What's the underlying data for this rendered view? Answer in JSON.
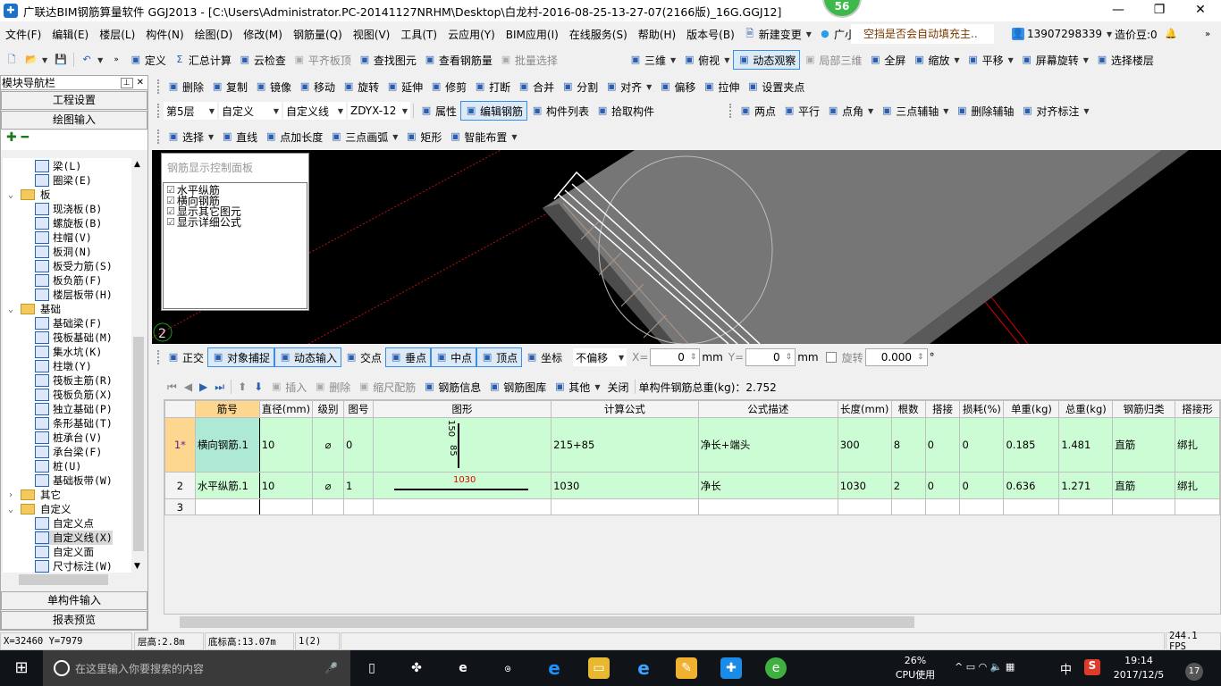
{
  "title": {
    "text": "广联达BIM钢筋算量软件 GGJ2013 - [C:\\Users\\Administrator.PC-20141127NRHM\\Desktop\\白龙村-2016-08-25-13-27-07(2166版)_16G.GGJ12]",
    "badge": "56",
    "min": "—",
    "max": "❐",
    "close": "✕"
  },
  "menu": [
    "文件(F)",
    "编辑(E)",
    "楼层(L)",
    "构件(N)",
    "绘图(D)",
    "修改(M)",
    "钢筋量(Q)",
    "视图(V)",
    "工具(T)",
    "云应用(Y)",
    "BIM应用(I)",
    "在线服务(S)",
    "帮助(H)",
    "版本号(B)"
  ],
  "menu_right": {
    "new_change": "新建变更",
    "assistant": "广小二",
    "notice": "空挡是否会自动填充主..",
    "phone": "13907298339",
    "beans": "造价豆:0"
  },
  "toolbar1": [
    {
      "label": "定义",
      "icon": "define"
    },
    {
      "label": "汇总计算",
      "icon": "Σ"
    },
    {
      "label": "云检查",
      "icon": "cloud-check"
    },
    {
      "label": "平齐板顶",
      "icon": "align-top",
      "disabled": true
    },
    {
      "label": "查找图元",
      "icon": "binoculars"
    },
    {
      "label": "查看钢筋量",
      "icon": "view-rebar"
    },
    {
      "label": "批量选择",
      "icon": "batch-select",
      "disabled": true
    }
  ],
  "toolbar1_right": [
    {
      "label": "三维",
      "icon": "cube",
      "dd": true
    },
    {
      "label": "俯视",
      "icon": "top-view",
      "dd": true
    },
    {
      "label": "动态观察",
      "icon": "orbit",
      "active": true
    },
    {
      "label": "局部三维",
      "icon": "local-3d",
      "disabled": true
    },
    {
      "label": "全屏",
      "icon": "fullscreen"
    },
    {
      "label": "缩放",
      "icon": "zoom",
      "dd": true
    },
    {
      "label": "平移",
      "icon": "pan",
      "dd": true
    },
    {
      "label": "屏幕旋转",
      "icon": "rotate-screen",
      "dd": true
    },
    {
      "label": "选择楼层",
      "icon": "select-floor"
    }
  ],
  "toolbar2": [
    {
      "label": "删除",
      "icon": "delete"
    },
    {
      "label": "复制",
      "icon": "copy"
    },
    {
      "label": "镜像",
      "icon": "mirror"
    },
    {
      "label": "移动",
      "icon": "move"
    },
    {
      "label": "旋转",
      "icon": "rotate"
    },
    {
      "label": "延伸",
      "icon": "extend"
    },
    {
      "label": "修剪",
      "icon": "trim"
    },
    {
      "label": "打断",
      "icon": "break"
    },
    {
      "label": "合并",
      "icon": "merge"
    },
    {
      "label": "分割",
      "icon": "split"
    },
    {
      "label": "对齐",
      "icon": "align",
      "dd": true
    },
    {
      "label": "偏移",
      "icon": "offset"
    },
    {
      "label": "拉伸",
      "icon": "stretch"
    },
    {
      "label": "设置夹点",
      "icon": "grip-point"
    }
  ],
  "toolbar3": {
    "floor": "第5层",
    "type": "自定义",
    "subtype": "自定义线",
    "name": "ZDYX-12",
    "buttons": [
      {
        "label": "属性",
        "icon": "properties"
      },
      {
        "label": "编辑钢筋",
        "icon": "edit-rebar",
        "active": true
      },
      {
        "label": "构件列表",
        "icon": "component-list"
      },
      {
        "label": "拾取构件",
        "icon": "pick"
      }
    ],
    "axis_buttons": [
      {
        "label": "两点",
        "icon": "two-point"
      },
      {
        "label": "平行",
        "icon": "parallel"
      },
      {
        "label": "点角",
        "icon": "point-angle",
        "dd": true
      },
      {
        "label": "三点辅轴",
        "icon": "three-point-axis",
        "dd": true
      },
      {
        "label": "删除辅轴",
        "icon": "delete-axis"
      },
      {
        "label": "对齐标注",
        "icon": "align-dimension",
        "dd": true
      }
    ]
  },
  "toolbar4": [
    {
      "label": "选择",
      "icon": "pointer",
      "dd": true
    },
    {
      "label": "直线",
      "icon": "line"
    },
    {
      "label": "点加长度",
      "icon": "point-length"
    },
    {
      "label": "三点画弧",
      "icon": "arc",
      "dd": true
    },
    {
      "label": "矩形",
      "icon": "rectangle"
    },
    {
      "label": "智能布置",
      "icon": "smart-layout",
      "dd": true
    }
  ],
  "left_panel": {
    "title": "模块导航栏",
    "tabs": [
      "工程设置",
      "绘图输入"
    ],
    "bottom_tabs": [
      "单构件输入",
      "报表预览"
    ],
    "tree": [
      {
        "label": "梁(L)",
        "level": 2
      },
      {
        "label": "圈梁(E)",
        "level": 2
      },
      {
        "label": "板",
        "level": 1,
        "open": true
      },
      {
        "label": "现浇板(B)",
        "level": 2
      },
      {
        "label": "螺旋板(B)",
        "level": 2
      },
      {
        "label": "柱帽(V)",
        "level": 2
      },
      {
        "label": "板洞(N)",
        "level": 2
      },
      {
        "label": "板受力筋(S)",
        "level": 2
      },
      {
        "label": "板负筋(F)",
        "level": 2
      },
      {
        "label": "楼层板带(H)",
        "level": 2
      },
      {
        "label": "基础",
        "level": 1,
        "open": true
      },
      {
        "label": "基础梁(F)",
        "level": 2
      },
      {
        "label": "筏板基础(M)",
        "level": 2
      },
      {
        "label": "集水坑(K)",
        "level": 2
      },
      {
        "label": "柱墩(Y)",
        "level": 2
      },
      {
        "label": "筏板主筋(R)",
        "level": 2
      },
      {
        "label": "筏板负筋(X)",
        "level": 2
      },
      {
        "label": "独立基础(P)",
        "level": 2
      },
      {
        "label": "条形基础(T)",
        "level": 2
      },
      {
        "label": "桩承台(V)",
        "level": 2
      },
      {
        "label": "承台梁(F)",
        "level": 2
      },
      {
        "label": "桩(U)",
        "level": 2
      },
      {
        "label": "基础板带(W)",
        "level": 2
      },
      {
        "label": "其它",
        "level": 1,
        "open": false
      },
      {
        "label": "自定义",
        "level": 1,
        "open": true
      },
      {
        "label": "自定义点",
        "level": 2
      },
      {
        "label": "自定义线(X)",
        "level": 2,
        "selected": true
      },
      {
        "label": "自定义面",
        "level": 2
      },
      {
        "label": "尺寸标注(W)",
        "level": 2
      }
    ]
  },
  "rebar_panel": {
    "title": "钢筋显示控制面板",
    "options": [
      {
        "label": "水平纵筋",
        "checked": true
      },
      {
        "label": "横向钢筋",
        "checked": true
      },
      {
        "label": "显示其它图元",
        "checked": true
      },
      {
        "label": "显示详细公式",
        "checked": true
      }
    ]
  },
  "viewport": {
    "axis_label": "2"
  },
  "snapbar": {
    "buttons": [
      {
        "label": "正交",
        "icon": "ortho"
      },
      {
        "label": "对象捕捉",
        "icon": "snap",
        "active": true
      },
      {
        "label": "动态输入",
        "icon": "dynamic-input",
        "active": true
      },
      {
        "label": "交点",
        "icon": "intersection"
      },
      {
        "label": "垂点",
        "icon": "perpendicular",
        "active": true
      },
      {
        "label": "中点",
        "icon": "midpoint",
        "active": true
      },
      {
        "label": "顶点",
        "icon": "vertex",
        "active": true
      },
      {
        "label": "坐标",
        "icon": "coordinate"
      }
    ],
    "offset_mode": "不偏移",
    "x_label": "X=",
    "x_value": "0",
    "y_label": "Y=",
    "y_value": "0",
    "unit": "mm",
    "rotate_label": "旋转",
    "rotate_value": "0.000",
    "degree": "°"
  },
  "table_toolbar": {
    "buttons": [
      {
        "label": "插入",
        "icon": "insert",
        "disabled": true
      },
      {
        "label": "删除",
        "icon": "delete",
        "disabled": true
      },
      {
        "label": "缩尺配筋",
        "icon": "scale-rebar",
        "disabled": true
      },
      {
        "label": "钢筋信息",
        "icon": "rebar-info"
      },
      {
        "label": "钢筋图库",
        "icon": "rebar-library"
      },
      {
        "label": "其他",
        "icon": "other",
        "dd": true
      },
      {
        "label": "关闭",
        "icon": ""
      }
    ],
    "total_label": "单构件钢筋总重(kg)：2.752"
  },
  "table": {
    "columns": [
      "",
      "筋号",
      "直径(mm)",
      "级别",
      "图号",
      "图形",
      "计算公式",
      "公式描述",
      "长度(mm)",
      "根数",
      "搭接",
      "损耗(%)",
      "单重(kg)",
      "总重(kg)",
      "钢筋归类",
      "搭接形"
    ],
    "rows": [
      {
        "idx": "1*",
        "name": "横向钢筋.1",
        "dia": "10",
        "grade": "⌀",
        "fig": "0",
        "shape_top": "150",
        "shape_side": "85",
        "formula": "215+85",
        "desc": "净长+端头",
        "len": "300",
        "count": "8",
        "lap": "0",
        "loss": "0",
        "unit_w": "0.185",
        "total_w": "1.481",
        "cat": "直筋",
        "lap_type": "绑扎"
      },
      {
        "idx": "2",
        "name": "水平纵筋.1",
        "dia": "10",
        "grade": "⌀",
        "fig": "1",
        "shape_len": "1030",
        "formula": "1030",
        "desc": "净长",
        "len": "1030",
        "count": "2",
        "lap": "0",
        "loss": "0",
        "unit_w": "0.636",
        "total_w": "1.271",
        "cat": "直筋",
        "lap_type": "绑扎"
      },
      {
        "idx": "3"
      }
    ]
  },
  "status": {
    "coords": "X=32460 Y=7979",
    "floor_h": "层高:2.8m",
    "base_h": "底标高:13.07m",
    "count": "1(2)",
    "fps": "244.1 FPS"
  },
  "taskbar": {
    "search": "在这里输入你要搜索的内容",
    "cpu": "26%",
    "cpu_label": "CPU使用",
    "ime": "中",
    "time": "19:14",
    "date": "2017/12/5",
    "notif": "17"
  },
  "colors": {
    "viewport_bg": "#000000",
    "row_green": "#ccfcd4",
    "row_header_active": "#fdd68f",
    "selected_cell": "#aee9d6",
    "accent": "#3a8ee6"
  }
}
